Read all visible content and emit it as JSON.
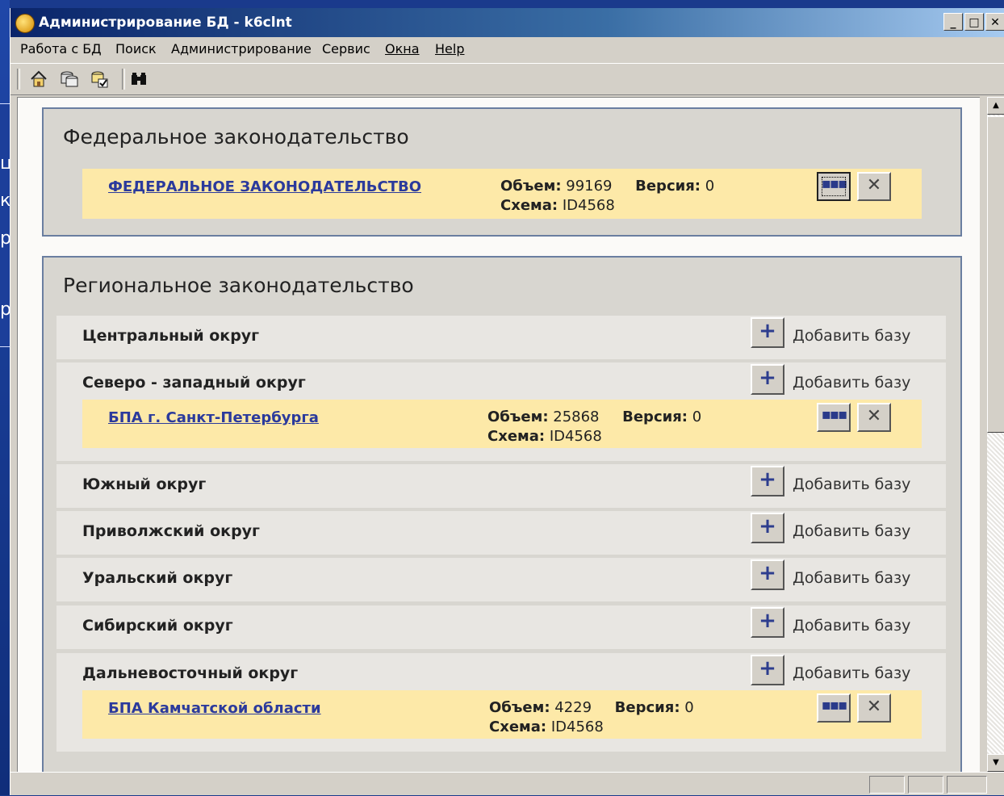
{
  "window": {
    "title": "Администрирование БД - k6clnt",
    "min_label": "_",
    "max_label": "□",
    "close_label": "✕"
  },
  "background_fragments": [
    "ц",
    "к",
    "р",
    "р"
  ],
  "menu": {
    "items": [
      {
        "label": "Работа с БД"
      },
      {
        "label": "Поиск"
      },
      {
        "label": "Администрирование"
      },
      {
        "label": "Сервис"
      },
      {
        "label": "Окна"
      },
      {
        "label": "Help"
      }
    ]
  },
  "toolbar": {
    "icons": [
      "home-icon",
      "databases-icon",
      "database-check-icon",
      "binoculars-icon"
    ]
  },
  "federal": {
    "title": "Федеральное законодательство",
    "db": {
      "name": "ФЕДЕРАЛЬНОЕ ЗАКОНОДАТЕЛЬСТВО",
      "volume_label": "Объем:",
      "volume": "99169",
      "version_label": "Версия:",
      "version": "0",
      "schema_label": "Схема:",
      "schema": "ID4568"
    }
  },
  "regional": {
    "title": "Региональное законодательство",
    "add_label": "Добавить базу",
    "add_symbol": "+",
    "dots_symbol": "▪▪▪",
    "delete_symbol": "✕",
    "regions": [
      {
        "name": "Центральный округ"
      },
      {
        "name": "Северо - западный округ",
        "db": {
          "name": "БПА г. Санкт-Петербурга",
          "volume": "25868",
          "version": "0",
          "schema": "ID4568"
        }
      },
      {
        "name": "Южный округ"
      },
      {
        "name": "Приволжский округ"
      },
      {
        "name": "Уральский округ"
      },
      {
        "name": "Сибирский округ"
      },
      {
        "name": "Дальневосточный округ",
        "db": {
          "name": "БПА Камчатской области",
          "volume": "4229",
          "version": "0",
          "schema": "ID4568"
        }
      }
    ]
  },
  "scroll": {
    "up": "▲",
    "down": "▼"
  }
}
